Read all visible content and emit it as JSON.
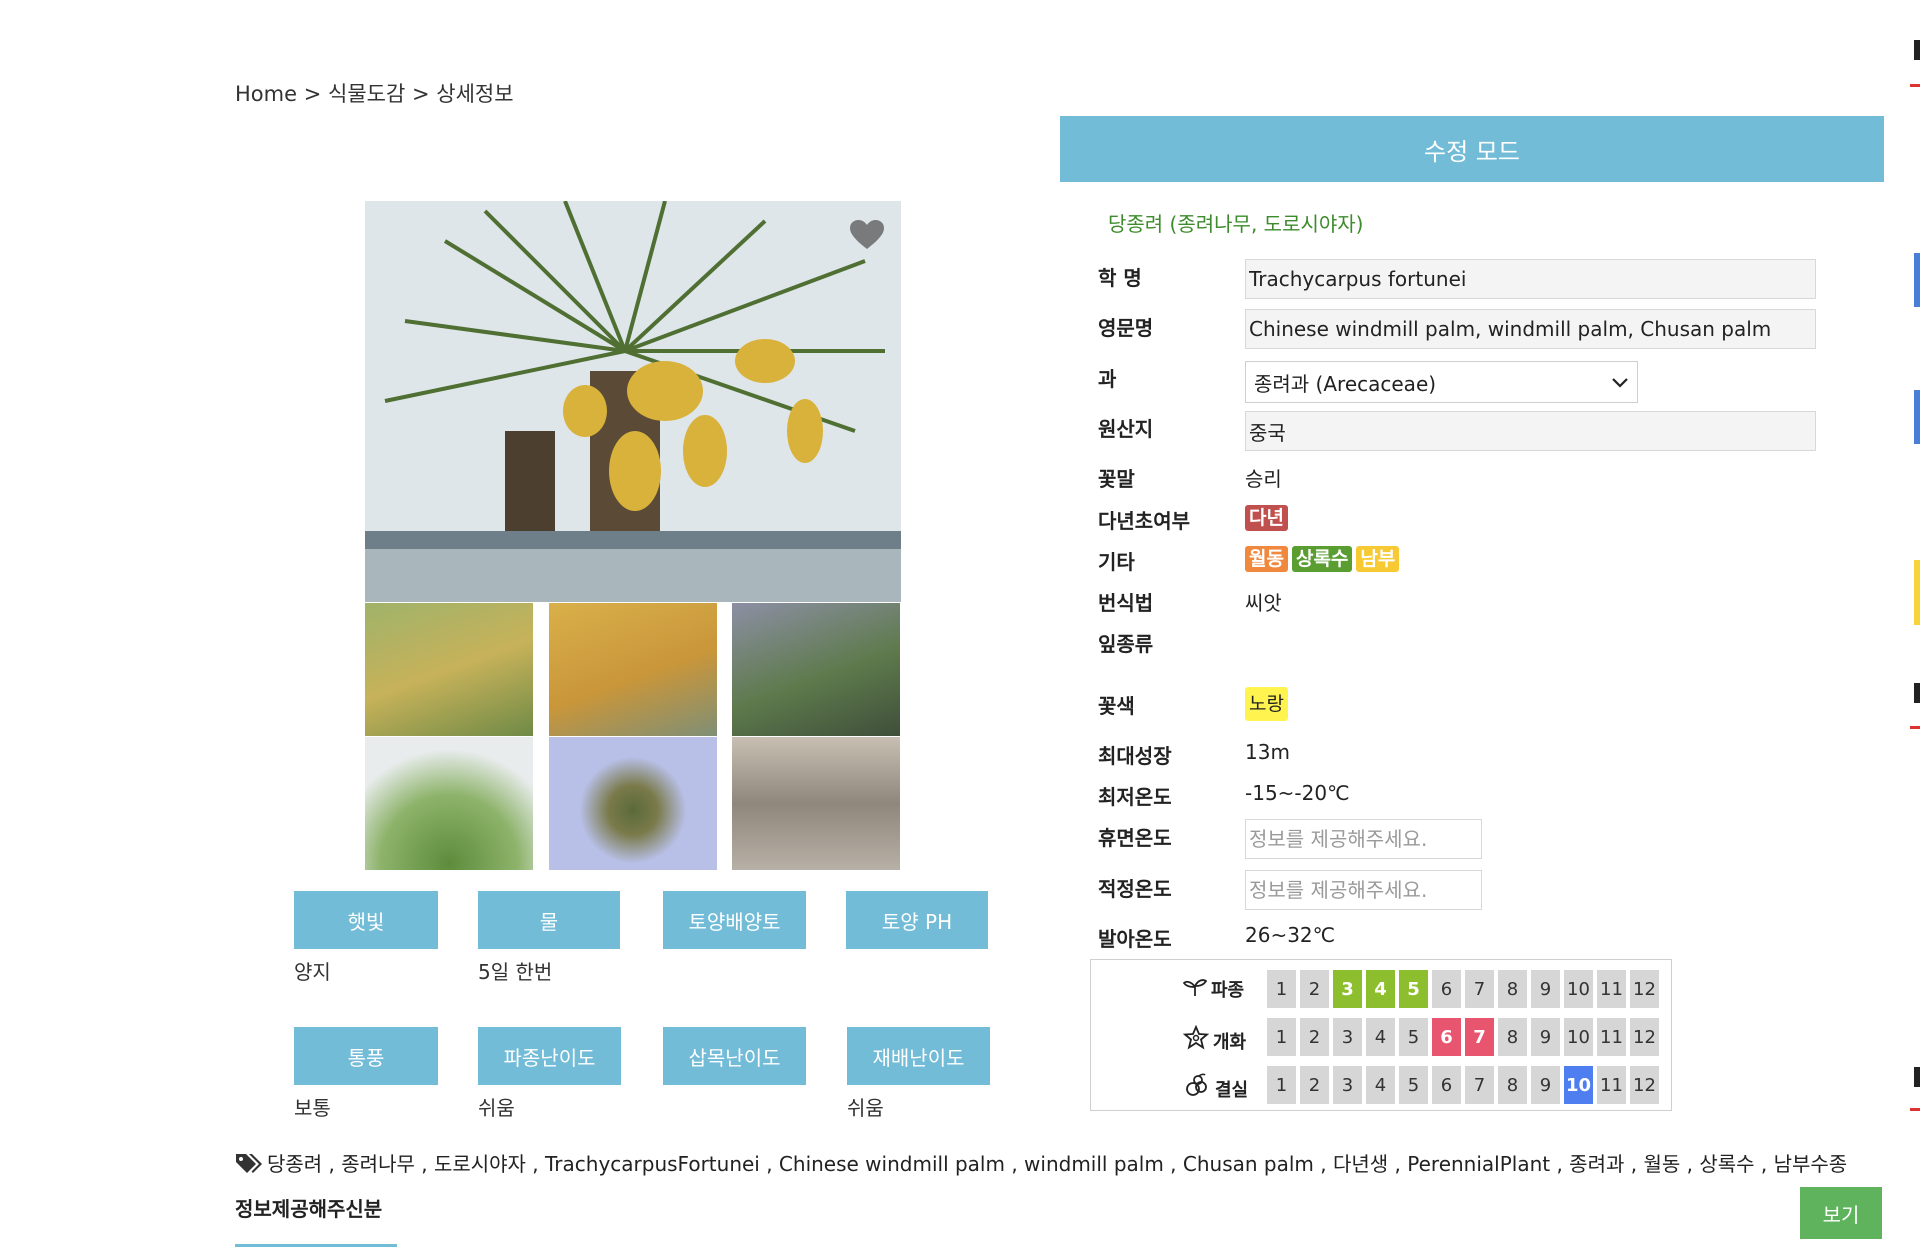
{
  "breadcrumb": {
    "home": "Home",
    "sep": ">",
    "category": "식물도감",
    "current": "상세정보"
  },
  "mode_bar": {
    "label": "수정 모드"
  },
  "plant": {
    "title": "당종려 (종려나무, 도로시야자)",
    "fields": {
      "scientific_label": "학 명",
      "scientific_value": "Trachycarpus fortunei",
      "english_label": "영문명",
      "english_value": "Chinese windmill palm, windmill palm, Chusan palm",
      "family_label": "과",
      "family_value": "종려과 (Arecaceae)",
      "origin_label": "원산지",
      "origin_value": "중국",
      "flower_lang_label": "꽃말",
      "flower_lang_value": "승리",
      "perennial_label": "다년초여부",
      "perennial_badge": "다년",
      "etc_label": "기타",
      "etc_badges": [
        "월동",
        "상록수",
        "남부"
      ],
      "propagation_label": "번식법",
      "propagation_value": "씨앗",
      "leaf_label": "잎종류",
      "flower_color_label": "꽃색",
      "flower_color_badge": "노랑",
      "max_growth_label": "최대성장",
      "max_growth_value": "13m",
      "min_temp_label": "최저온도",
      "min_temp_value": "-15~-20℃",
      "dormant_temp_label": "휴면온도",
      "dormant_temp_placeholder": "정보를 제공해주세요.",
      "proper_temp_label": "적정온도",
      "proper_temp_placeholder": "정보를 제공해주세요.",
      "germ_temp_label": "발아온도",
      "germ_temp_value": "26~32℃"
    }
  },
  "colors": {
    "accent": "#72bcd8",
    "perennial": "#c0504d",
    "etc": [
      "#f0883e",
      "#5a9e32",
      "#f7c933"
    ],
    "yellow_badge": "#fff44f",
    "sow_active": "#8cbe2e",
    "bloom_active": "#e8556e",
    "fruit_active": "#4f7ef0"
  },
  "care": {
    "row1": [
      {
        "label": "햇빛",
        "value": "양지"
      },
      {
        "label": "물",
        "value": "5일 한번"
      },
      {
        "label": "토양배양토",
        "value": ""
      },
      {
        "label": "토양 PH",
        "value": ""
      }
    ],
    "row2": [
      {
        "label": "통풍",
        "value": "보통"
      },
      {
        "label": "파종난이도",
        "value": "쉬움"
      },
      {
        "label": "삽목난이도",
        "value": ""
      },
      {
        "label": "재배난이도",
        "value": "쉬움"
      }
    ]
  },
  "calendar": {
    "months": [
      "1",
      "2",
      "3",
      "4",
      "5",
      "6",
      "7",
      "8",
      "9",
      "10",
      "11",
      "12"
    ],
    "rows": [
      {
        "label": "파종",
        "icon": "sprout-icon",
        "active": [
          3,
          4,
          5
        ]
      },
      {
        "label": "개화",
        "icon": "flower-icon",
        "active": [
          6,
          7
        ]
      },
      {
        "label": "결실",
        "icon": "fruit-icon",
        "active": [
          10
        ]
      }
    ]
  },
  "tags": {
    "text": "당종려 , 종려나무 , 도로시야자 , TrachycarpusFortunei , Chinese windmill palm , windmill palm , Chusan palm , 다년생 , PerennialPlant , 종려과 , 월동 , 상록수 , 남부수종"
  },
  "footer": {
    "note": "정보제공해주신분",
    "view_button": "보기"
  }
}
